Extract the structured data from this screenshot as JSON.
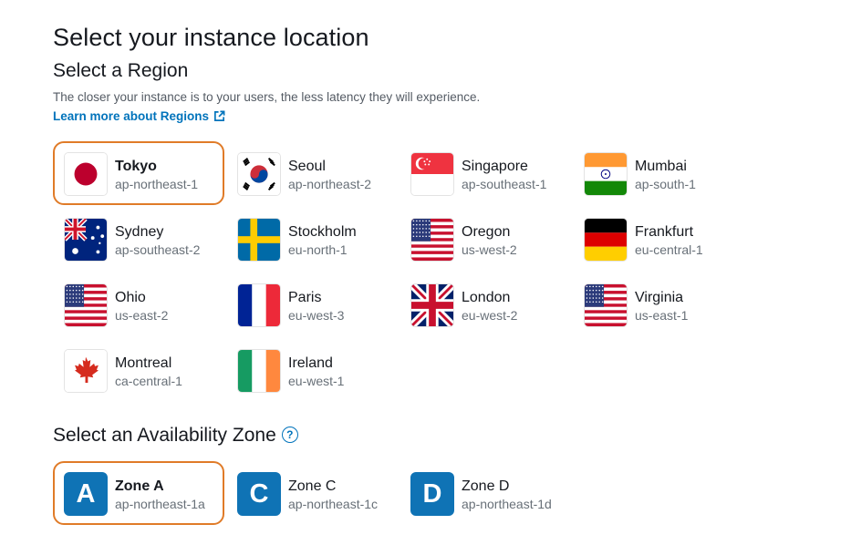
{
  "page": {
    "title": "Select your instance location",
    "region_heading": "Select a Region",
    "description": "The closer your instance is to your users, the less latency they will experience.",
    "learn_more": "Learn more about Regions",
    "zone_heading": "Select an Availability Zone",
    "help_glyph": "?"
  },
  "colors": {
    "selected_border": "#e07b28",
    "link": "#0073bb",
    "zone_badge": "#0f73b5"
  },
  "regions": [
    {
      "name": "Tokyo",
      "code": "ap-northeast-1",
      "flag": "japan-flag-icon",
      "selected": true
    },
    {
      "name": "Seoul",
      "code": "ap-northeast-2",
      "flag": "south-korea-flag-icon",
      "selected": false
    },
    {
      "name": "Singapore",
      "code": "ap-southeast-1",
      "flag": "singapore-flag-icon",
      "selected": false
    },
    {
      "name": "Mumbai",
      "code": "ap-south-1",
      "flag": "india-flag-icon",
      "selected": false
    },
    {
      "name": "Sydney",
      "code": "ap-southeast-2",
      "flag": "australia-flag-icon",
      "selected": false
    },
    {
      "name": "Stockholm",
      "code": "eu-north-1",
      "flag": "sweden-flag-icon",
      "selected": false
    },
    {
      "name": "Oregon",
      "code": "us-west-2",
      "flag": "usa-flag-icon",
      "selected": false
    },
    {
      "name": "Frankfurt",
      "code": "eu-central-1",
      "flag": "germany-flag-icon",
      "selected": false
    },
    {
      "name": "Ohio",
      "code": "us-east-2",
      "flag": "usa-flag-icon",
      "selected": false
    },
    {
      "name": "Paris",
      "code": "eu-west-3",
      "flag": "france-flag-icon",
      "selected": false
    },
    {
      "name": "London",
      "code": "eu-west-2",
      "flag": "uk-flag-icon",
      "selected": false
    },
    {
      "name": "Virginia",
      "code": "us-east-1",
      "flag": "usa-flag-icon",
      "selected": false
    },
    {
      "name": "Montreal",
      "code": "ca-central-1",
      "flag": "canada-flag-icon",
      "selected": false
    },
    {
      "name": "Ireland",
      "code": "eu-west-1",
      "flag": "ireland-flag-icon",
      "selected": false
    }
  ],
  "zones": [
    {
      "letter": "A",
      "name": "Zone A",
      "code": "ap-northeast-1a",
      "selected": true
    },
    {
      "letter": "C",
      "name": "Zone C",
      "code": "ap-northeast-1c",
      "selected": false
    },
    {
      "letter": "D",
      "name": "Zone D",
      "code": "ap-northeast-1d",
      "selected": false
    }
  ]
}
